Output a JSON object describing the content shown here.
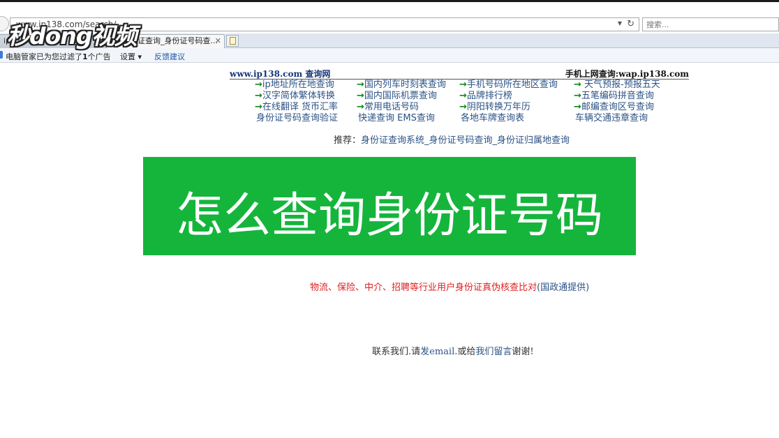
{
  "browser": {
    "url": "www.ip138.com/search/",
    "search_placeholder": "搜索...",
    "tabs": [
      {
        "label": "ip138.com"
      },
      {
        "label": "身份证查询_身份证号码查..."
      }
    ],
    "infobar": {
      "prefix": "电脑管家已为您过滤了",
      "count": "1",
      "suffix": "个广告",
      "settings": "设置 ▾",
      "feedback": "反馈建议"
    }
  },
  "watermark": {
    "text": "秒dong视频"
  },
  "page": {
    "site_name": "www.ip138.com 查询网",
    "mobile": "手机上网查询:wap.ip138.com",
    "arrow": "→",
    "grid": [
      [
        {
          "text": "ip地址所在地查询",
          "arrow": true
        },
        {
          "text": "国内列车时刻表查询",
          "arrow": true
        },
        {
          "text": "手机号码所在地区查询",
          "arrow": true
        },
        {
          "text": " 天气预报-预报五天",
          "arrow": true
        }
      ],
      [
        {
          "text": "汉字简体繁体转换",
          "arrow": true
        },
        {
          "text": "国内国际机票查询",
          "arrow": true
        },
        {
          "text": "品牌排行榜",
          "arrow": true
        },
        {
          "text": "五笔编码拼音查询",
          "arrow": true
        }
      ],
      [
        {
          "text": "在线翻译 货币汇率",
          "arrow": true
        },
        {
          "text": "常用电话号码",
          "arrow": true
        },
        {
          "text": "阴阳转换万年历",
          "arrow": true
        },
        {
          "text": "邮编查询区号查询",
          "arrow": true
        }
      ],
      [
        {
          "text": "身份证号码查询验证",
          "arrow": false
        },
        {
          "text": "快递查询 EMS查询",
          "arrow": false
        },
        {
          "text": "各地车牌查询表",
          "arrow": false
        },
        {
          "text": "车辆交通违章查询",
          "arrow": false
        }
      ]
    ],
    "recommend_label": "推荐：",
    "recommend_link": "身份证查询系统_身份证号码查询_身份证归属地查询",
    "banner": "怎么查询身份证号码",
    "verify_red": "物流、保险、中介、招聘等行业用户身份证真伪核查比对",
    "verify_blue": "(国政通提供)",
    "contact_prefix": "联系我们.请",
    "contact_email": "发email",
    "contact_middle": ".或给",
    "contact_message": "我们留言",
    "contact_suffix": "谢谢!"
  },
  "colors": {
    "banner_bg": "#15b53c",
    "link": "#2c5285",
    "arrow": "#0d8a18",
    "warning": "#e02020"
  }
}
